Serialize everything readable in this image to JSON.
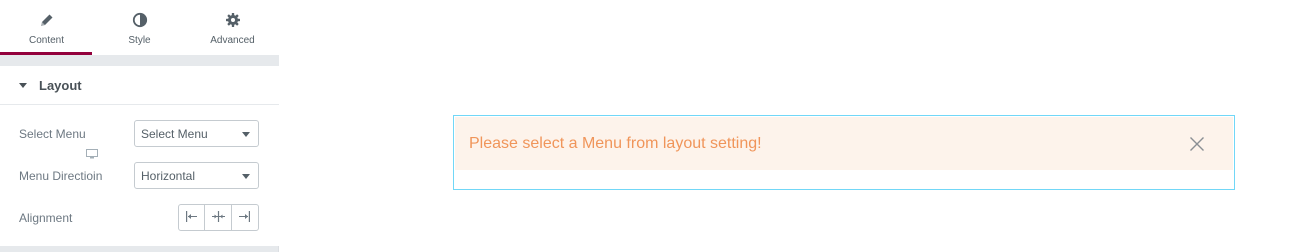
{
  "tabs": [
    {
      "label": "Content",
      "icon": "pencil-icon",
      "active": true
    },
    {
      "label": "Style",
      "icon": "half-circle-icon",
      "active": false
    },
    {
      "label": "Advanced",
      "icon": "gear-icon",
      "active": false
    }
  ],
  "section": {
    "title": "Layout",
    "controls": {
      "select_menu": {
        "label": "Select Menu",
        "value": "Select Menu"
      },
      "menu_direction": {
        "label": "Menu Directioin",
        "value": "Horizontal"
      },
      "alignment": {
        "label": "Alignment",
        "options": [
          "align-left-icon",
          "align-center-icon",
          "align-right-icon"
        ]
      }
    }
  },
  "notice": {
    "message": "Please select a Menu from layout setting!"
  },
  "colors": {
    "accent": "#93003c",
    "notice_bg": "#fdf3eb",
    "notice_text": "#f0955a",
    "widget_border": "#71d7f7"
  }
}
